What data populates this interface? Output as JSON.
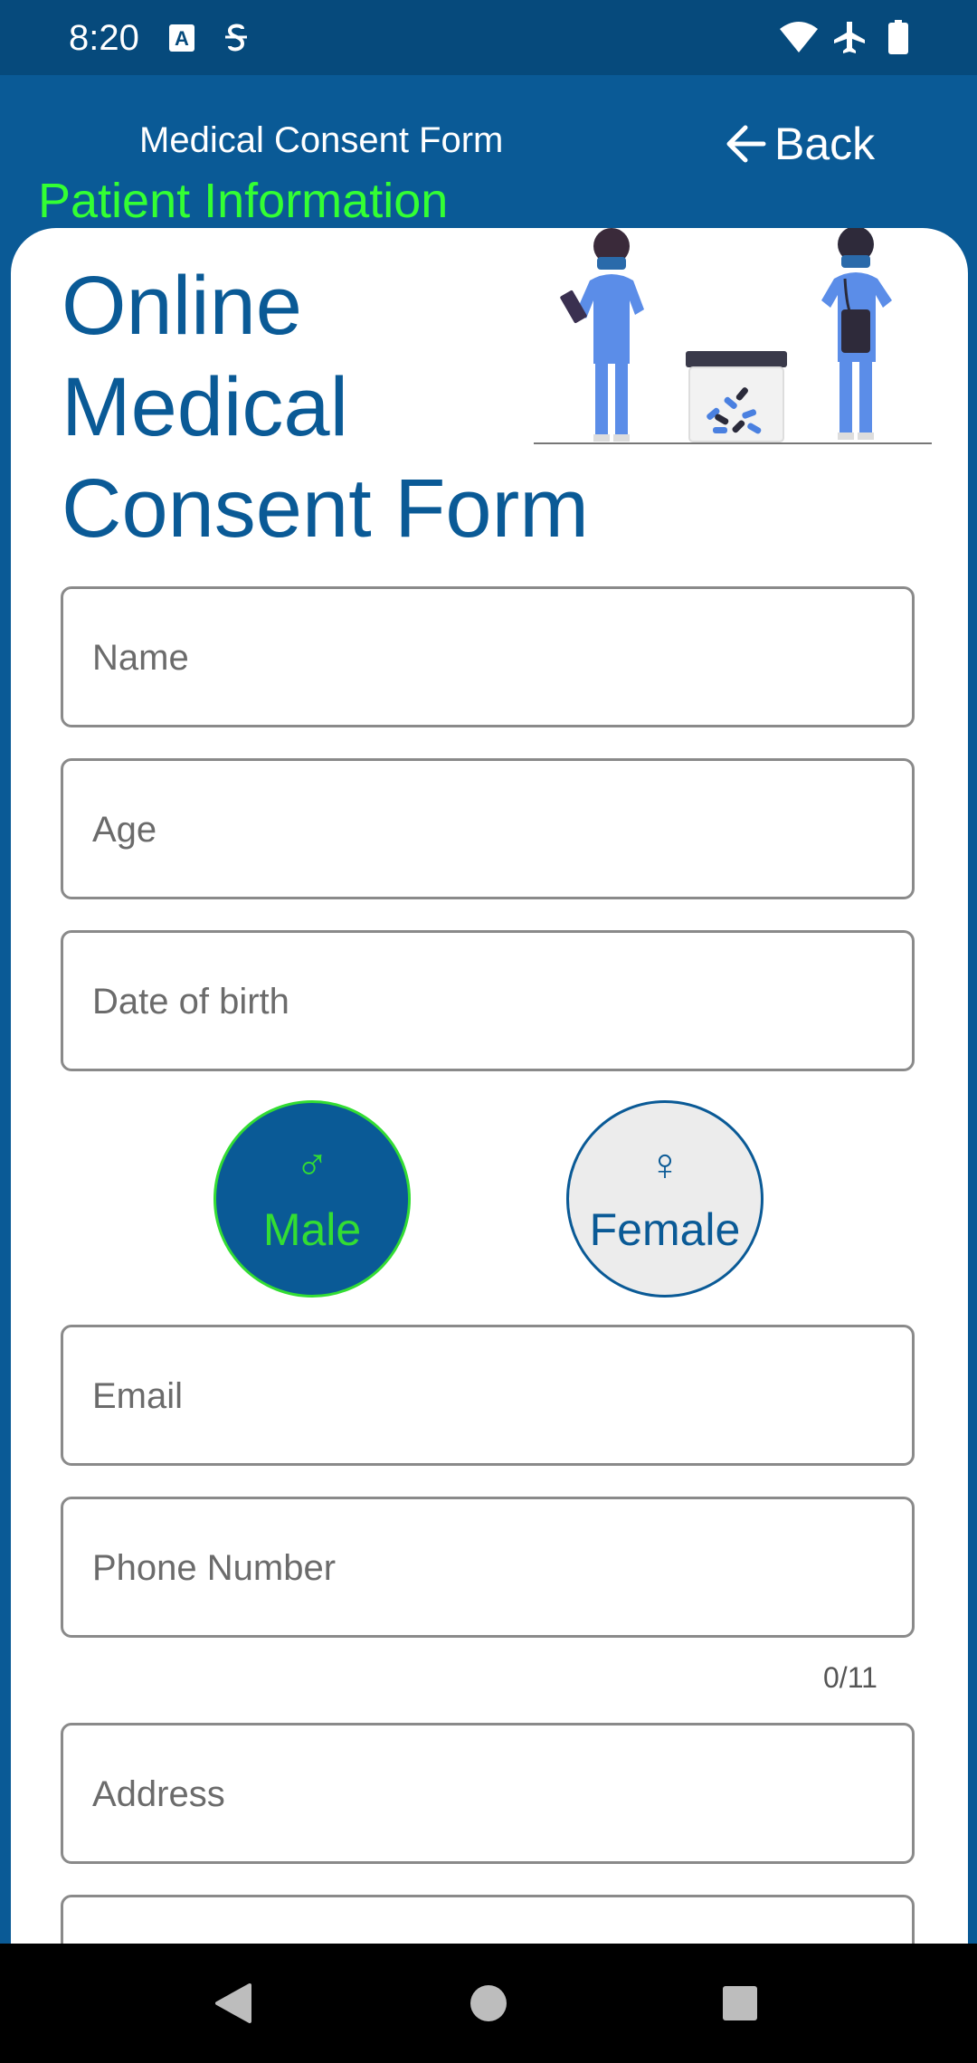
{
  "status_bar": {
    "time": "8:20",
    "icons": [
      "font-a-icon",
      "s-circle-icon",
      "wifi-icon",
      "airplane-icon",
      "battery-icon"
    ]
  },
  "app_bar": {
    "title": "Medical Consent Form",
    "back_label": "Back"
  },
  "section_title": "Patient Information",
  "heading": {
    "line1": "Online",
    "line2": "Medical",
    "line3": "Consent Form"
  },
  "form": {
    "name_placeholder": "Name",
    "age_placeholder": "Age",
    "dob_placeholder": "Date of birth",
    "email_placeholder": "Email",
    "phone_placeholder": "Phone Number",
    "phone_counter": "0/11",
    "address_placeholder": "Address"
  },
  "gender": {
    "male_label": "Male",
    "male_symbol": "♂",
    "female_label": "Female",
    "female_symbol": "♀",
    "selected": "Male"
  },
  "colors": {
    "primary": "#0a5a96",
    "status_bar": "#064a7c",
    "accent_green": "#33ff33"
  }
}
